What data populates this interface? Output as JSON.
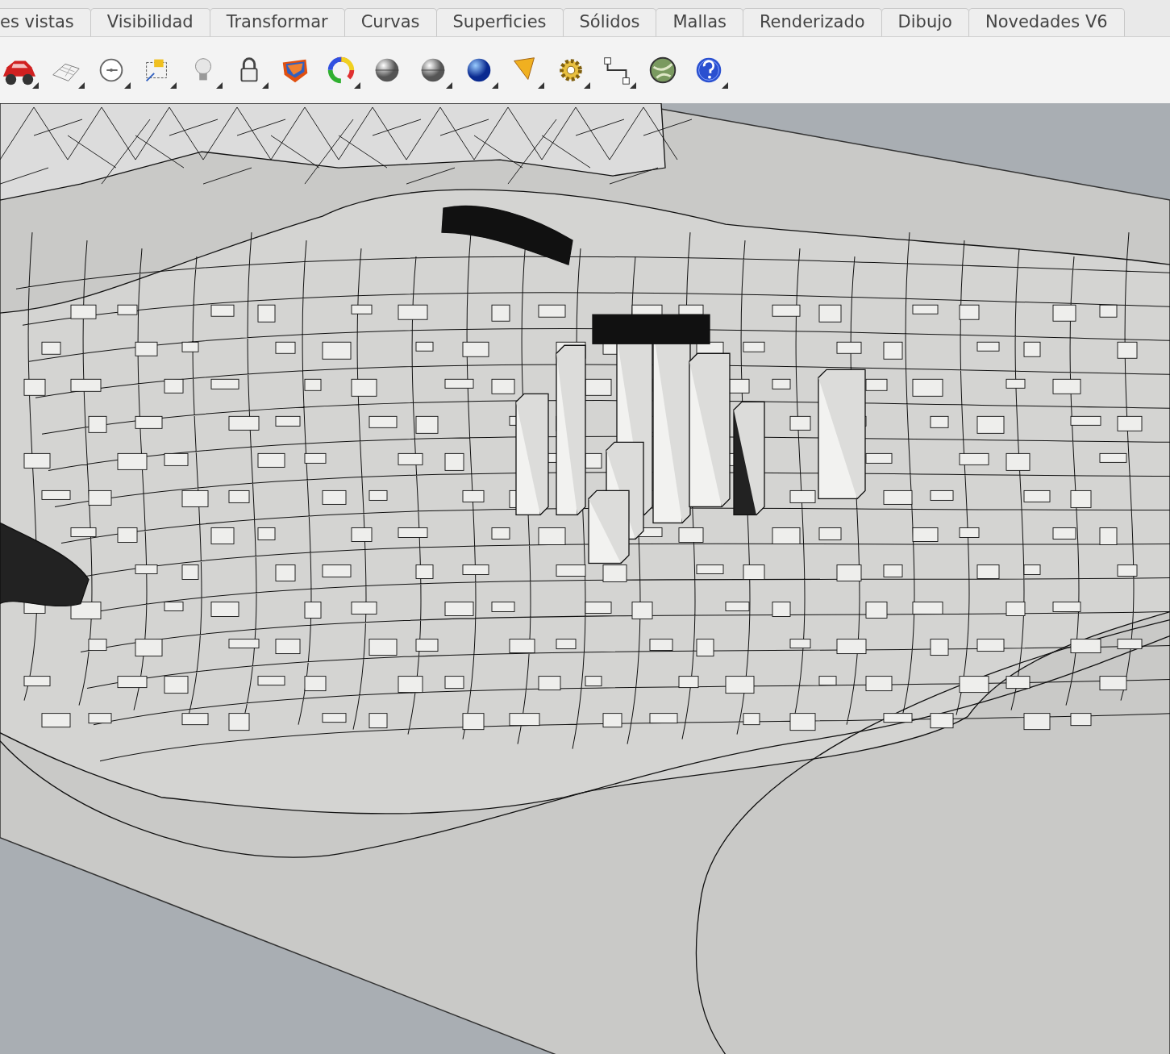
{
  "tabs": [
    {
      "label": "es vistas"
    },
    {
      "label": "Visibilidad"
    },
    {
      "label": "Transformar"
    },
    {
      "label": "Curvas"
    },
    {
      "label": "Superficies"
    },
    {
      "label": "Sólidos"
    },
    {
      "label": "Mallas"
    },
    {
      "label": "Renderizado"
    },
    {
      "label": "Dibujo"
    },
    {
      "label": "Novedades V6"
    }
  ],
  "toolbar": {
    "buttons": [
      {
        "kind": "car",
        "flyout": true
      },
      {
        "kind": "plane",
        "flyout": true
      },
      {
        "kind": "target",
        "flyout": true
      },
      {
        "kind": "frame",
        "flyout": true
      },
      {
        "kind": "bulb",
        "flyout": true
      },
      {
        "kind": "lock",
        "flyout": true
      },
      {
        "kind": "layers",
        "flyout": false
      },
      {
        "kind": "wheel",
        "flyout": true
      },
      {
        "kind": "sphere",
        "flyout": false
      },
      {
        "kind": "sphere",
        "flyout": true
      },
      {
        "kind": "ball",
        "flyout": true
      },
      {
        "kind": "cone",
        "flyout": true
      },
      {
        "kind": "gear",
        "flyout": true
      },
      {
        "kind": "connector",
        "flyout": true
      },
      {
        "kind": "globe",
        "flyout": false
      },
      {
        "kind": "help",
        "flyout": true
      }
    ]
  }
}
